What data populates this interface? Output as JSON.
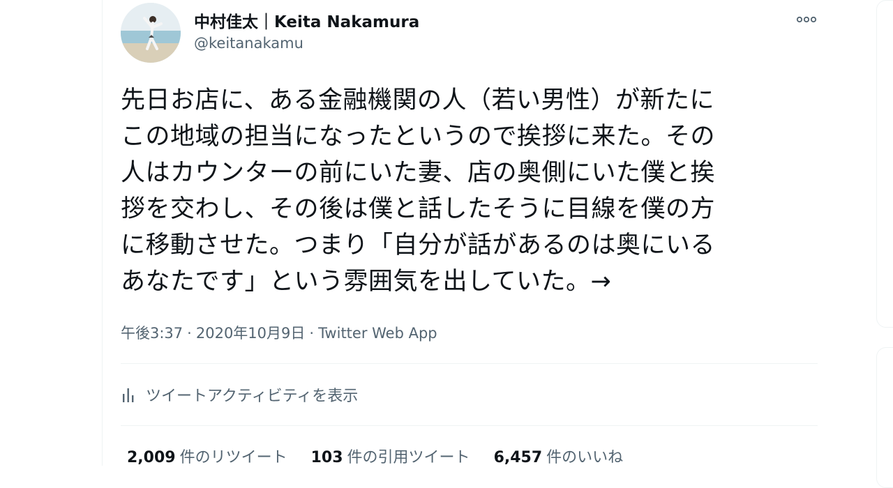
{
  "tweet": {
    "author": {
      "name": "中村佳太｜Keita Nakamura",
      "handle": "@keitanakamu"
    },
    "text_lines": [
      "先日お店に、ある金融機関の人（若い男性）が新たに",
      "この地域の担当になったというので挨拶に来た。その",
      "人はカウンターの前にいた妻、店の奥側にいた僕と挨",
      "拶を交わし、その後は僕と話したそうに目線を僕の方",
      "に移動させた。つまり「自分が話があるのは奥にいる",
      "あなたです」という雰囲気を出していた。→"
    ],
    "time": "午後3:37",
    "date": "2020年10月9日",
    "separator": "·",
    "source": "Twitter Web App",
    "activity_label": "ツイートアクティビティを表示",
    "stats": {
      "retweets": {
        "count": "2,009",
        "label": "件のリツイート"
      },
      "quotes": {
        "count": "103",
        "label": "件の引用ツイート"
      },
      "likes": {
        "count": "6,457",
        "label": "件のいいね"
      }
    }
  },
  "icons": {
    "more": "more-horizontal-icon",
    "activity": "bar-chart-icon"
  },
  "colors": {
    "text_primary": "#0f1419",
    "text_secondary": "#536471",
    "border": "#eff3f4"
  }
}
